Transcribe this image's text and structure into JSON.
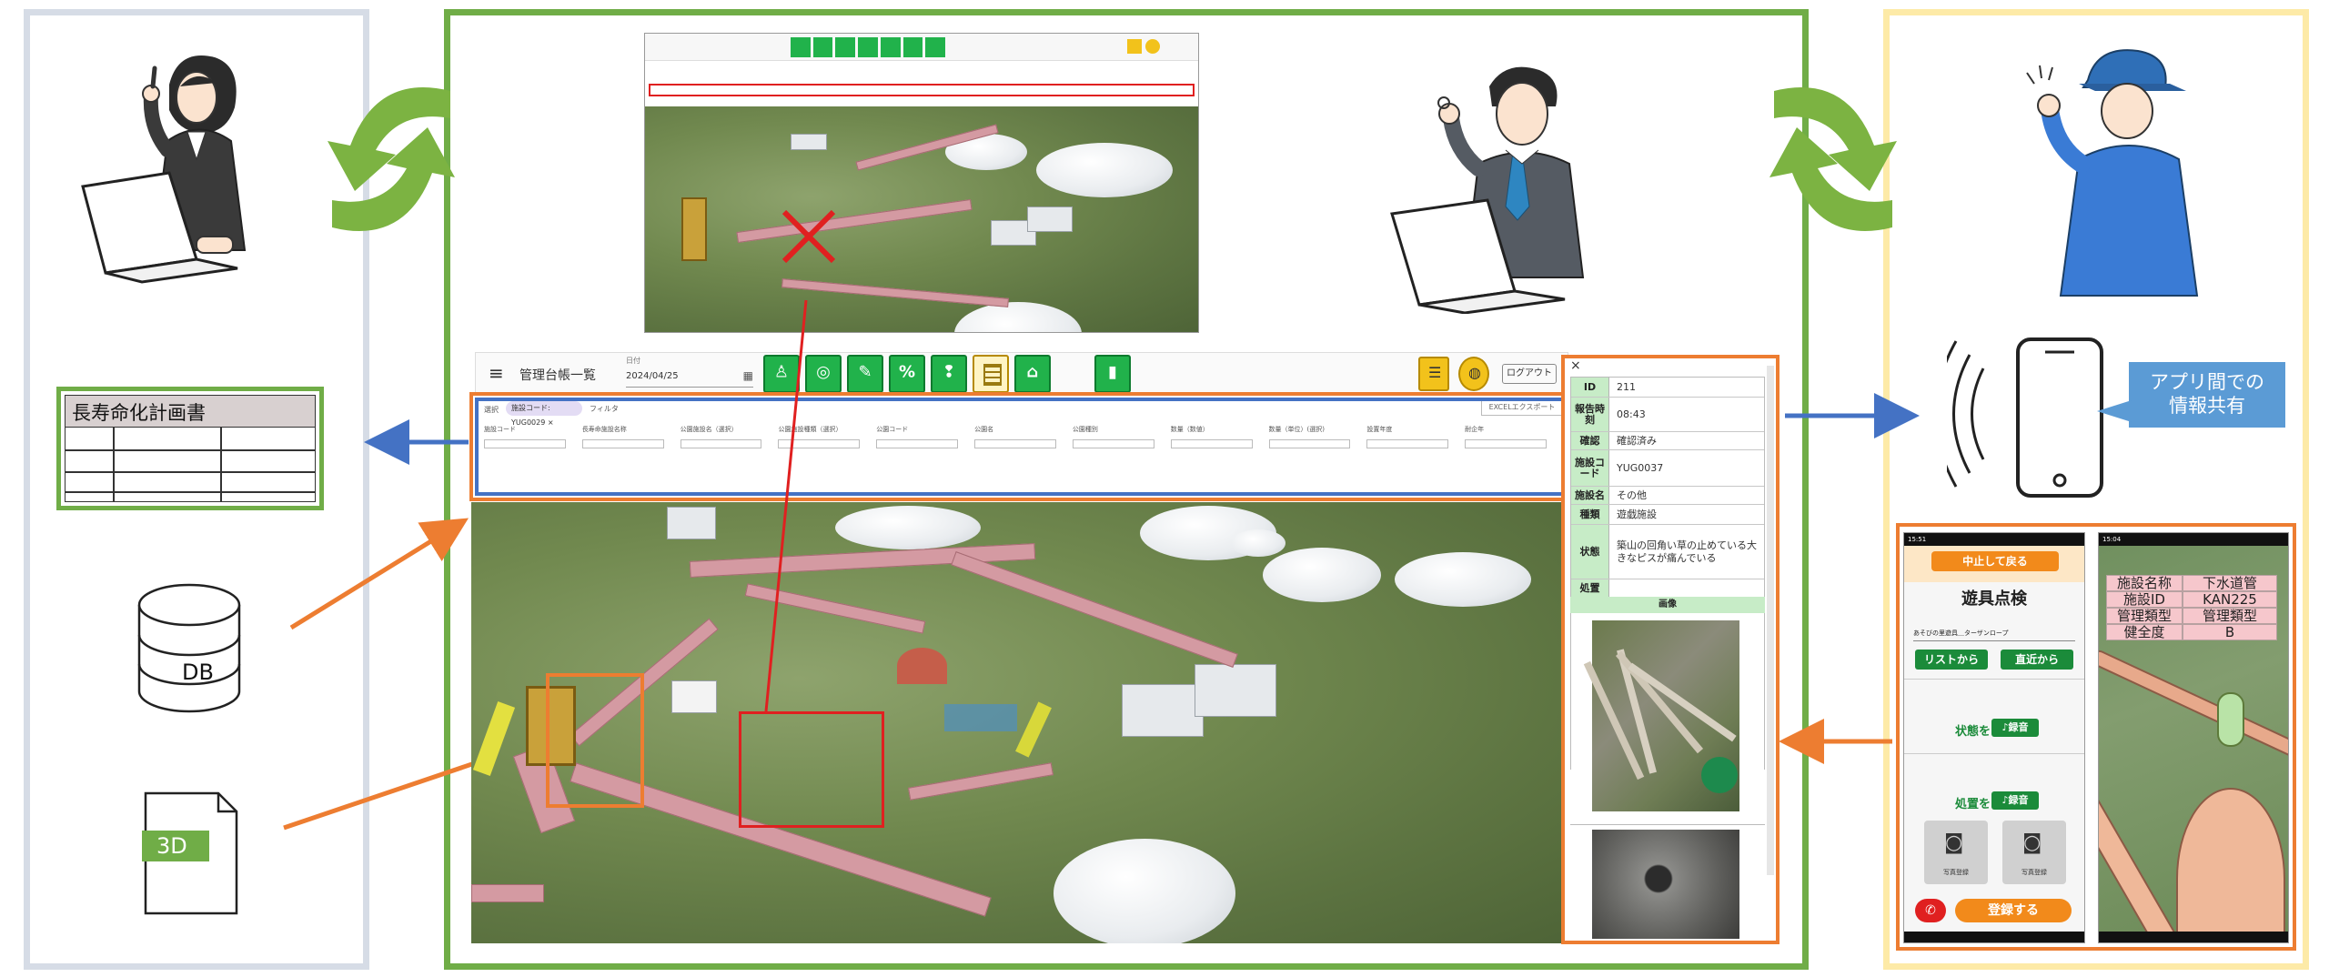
{
  "left_panel": {
    "plan_document_title": "長寿命化計画書",
    "db_label": "DB",
    "model_label": "3D"
  },
  "ledger": {
    "title": "管理台帳一覧",
    "date_label": "日付",
    "date_value": "2024/04/25",
    "logout_label": "ログアウト",
    "filter_scope_label": "選択",
    "filter_chip": "施設コード: YUG0029",
    "filter_label": "フィルタ",
    "export_label": "EXCELエクスポート",
    "columns": [
      "施設コード",
      "長寿命施設名称",
      "公園施設名（選択）",
      "公園施設種類（選択）",
      "公園コード",
      "公園名",
      "公園種別",
      "数量（数値）",
      "数量（単位）(選択)",
      "設置年度",
      "耐企年"
    ]
  },
  "detail": {
    "rows": [
      {
        "key": "ID",
        "value": "211"
      },
      {
        "key": "報告時刻",
        "value": "08:43"
      },
      {
        "key": "確認",
        "value": "確認済み"
      },
      {
        "key": "施設コード",
        "value": "YUG0037"
      },
      {
        "key": "施設名",
        "value": "その他"
      },
      {
        "key": "種類",
        "value": "遊戯施設"
      },
      {
        "key": "状態",
        "value": "築山の回角い草の止めている大きなピスが痛んでいる"
      },
      {
        "key": "処置",
        "value": ""
      }
    ],
    "image_header": "画像"
  },
  "right_panel": {
    "share_callout": "アプリ間での\n情報共有"
  },
  "phone_app": {
    "status_time": "15:51",
    "back_button": "中止して戻る",
    "screen_title": "遊具点検",
    "target_name": "あそびの里遊具＿ターザンロープ",
    "from_list_button": "リストから",
    "nearby_button": "直近から",
    "state_label": "状態を",
    "state_record_button": "録音",
    "treatment_label": "処置を",
    "treatment_record_button": "録音",
    "photo_button_1": "写真登録",
    "photo_button_2": "写真登録",
    "register_button": "登録する"
  },
  "phone_3d": {
    "status_time": "15:04",
    "rows": [
      {
        "key": "施設名称",
        "value": "下水道管"
      },
      {
        "key": "施設ID",
        "value": "KAN225"
      },
      {
        "key": "管理類型",
        "value": "管理類型"
      },
      {
        "key": "健全度",
        "value": "B"
      }
    ]
  },
  "colors": {
    "left_border": "#d6dce6",
    "center_border": "#70ad47",
    "right_border": "#fdeaa7",
    "recycle_arrows": "#7cb342",
    "orange_highlight": "#ed7d31",
    "blue_highlight": "#4472c4",
    "red_marker": "#e02020"
  }
}
